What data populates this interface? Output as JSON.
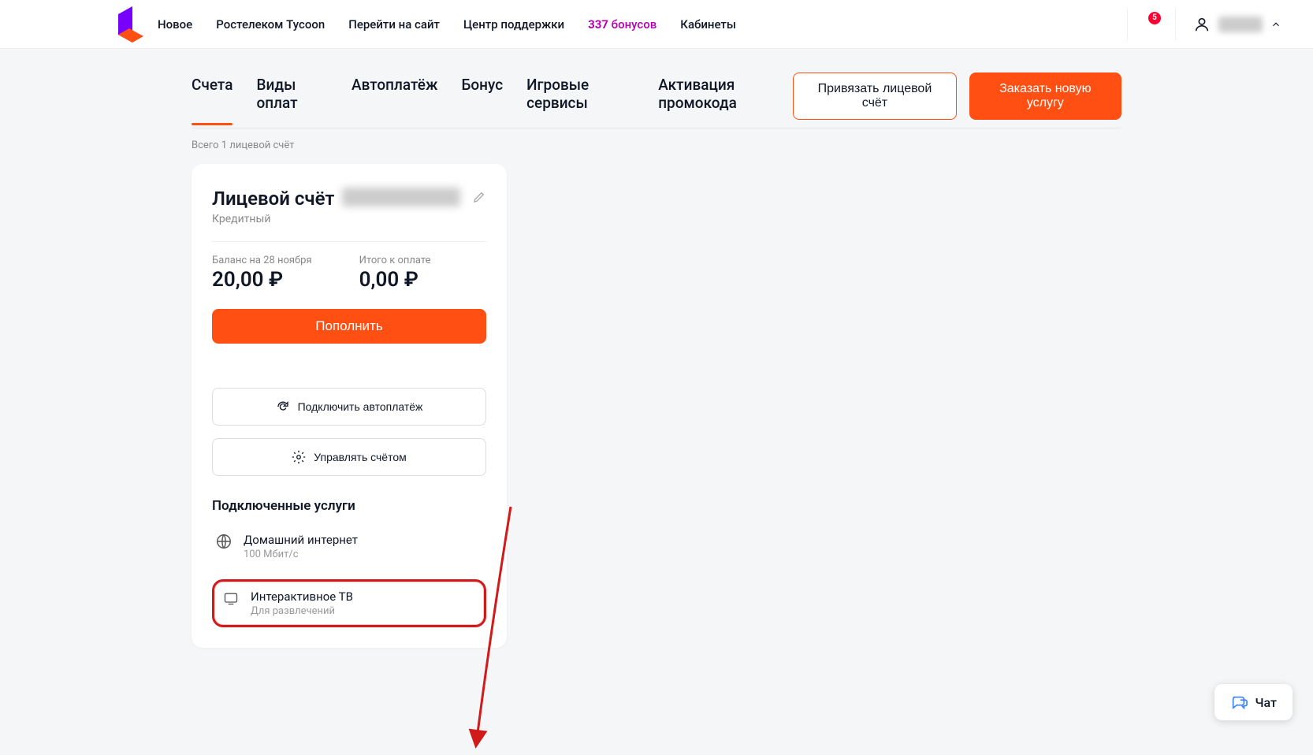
{
  "header": {
    "nav": {
      "new": "Новое",
      "tycoon": "Ростелеком Tycoon",
      "goto_site": "Перейти на сайт",
      "support": "Центр поддержки",
      "bonus_count": "337",
      "bonus_word": "бонусов",
      "cabinets": "Кабинеты"
    },
    "notifications_count": "5"
  },
  "tabs": {
    "accounts": "Счета",
    "payment_types": "Виды оплат",
    "autopay": "Автоплатёж",
    "bonus": "Бонус",
    "game_services": "Игровые сервисы",
    "promo": "Активация промокода"
  },
  "actions": {
    "link_account": "Привязать лицевой счёт",
    "order_service": "Заказать новую услугу"
  },
  "subtitle": "Всего 1 лицевой счёт",
  "card": {
    "title_prefix": "Лицевой счёт",
    "type": "Кредитный",
    "balance_label": "Баланс на 28 ноября",
    "balance_value": "20,00 ₽",
    "due_label": "Итого к оплате",
    "due_value": "0,00 ₽",
    "topup": "Пополнить",
    "connect_autopay": "Подключить автоплатёж",
    "manage_account": "Управлять счётом",
    "services_title": "Подключенные услуги",
    "service_internet": {
      "name": "Домашний интернет",
      "sub": "100 Мбит/с"
    },
    "service_tv": {
      "name": "Интерактивное ТВ",
      "sub": "Для развлечений"
    }
  },
  "chat": {
    "label": "Чат"
  }
}
